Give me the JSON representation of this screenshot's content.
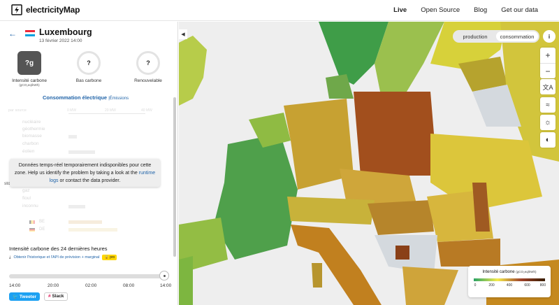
{
  "navbar": {
    "logo_text": "electricityMap",
    "links": [
      "Live",
      "Open Source",
      "Blog",
      "Get our data"
    ]
  },
  "zone": {
    "name": "Luxembourg",
    "datetime": "13 février 2022 14:00",
    "flag_colors": [
      "#ed2939",
      "#ffffff",
      "#00a1de"
    ]
  },
  "kpis": {
    "intensity_value": "?g",
    "intensity_label": "Intensité carbone",
    "intensity_unit": "(gCO₂eq/kWh)",
    "low_carbon_value": "?",
    "low_carbon_label": "Bas carbone",
    "renewable_value": "?",
    "renewable_label": "Renouvelable"
  },
  "consumption": {
    "title": "Consommation électrique",
    "emissions_link": "Émissions",
    "by_source": "par source",
    "axis_ticks": [
      "0 MW",
      "20 MW",
      "40 MW"
    ],
    "sources": [
      "nucléaire",
      "géothermie",
      "biomasse",
      "charbon",
      "éolien",
      "gaz",
      "fioul",
      "inconnu"
    ],
    "exchanges": [
      "BE",
      "DE"
    ],
    "storage_label": "stoc"
  },
  "tooltip": {
    "text_before": "Données temps-réel temporairement indisponibles pour cette zone. Help us identify the problem by taking a look at the",
    "link": "runtime logs",
    "text_after": "or contact the data provider."
  },
  "history": {
    "title": "Intensité carbone des 24 dernières heures",
    "download": "Obtenir l'historique et l'API de prévision + marginal",
    "pro": "pro",
    "times": [
      "14:00",
      "20:00",
      "02:00",
      "08:00",
      "14:00"
    ]
  },
  "social": {
    "tweet": "Tweeter",
    "slack": "Slack"
  },
  "map": {
    "toggle": [
      "production",
      "consommation"
    ],
    "toggle_active": "consommation",
    "info": "i",
    "zoom_in": "+",
    "zoom_out": "−",
    "controls": [
      "translate-icon",
      "wind-icon",
      "sun-icon",
      "dark-mode-icon"
    ]
  },
  "legend": {
    "title": "Intensité carbone",
    "unit": "(gCO₂eq/kWh)",
    "ticks": [
      "0",
      "200",
      "400",
      "600",
      "800"
    ],
    "colors": [
      "#2aa364",
      "#f5eb4d",
      "#9e4229",
      "#381d02"
    ]
  },
  "colors": {
    "accent": "#1f63a8",
    "unknown_zone": "#d4d9de"
  }
}
